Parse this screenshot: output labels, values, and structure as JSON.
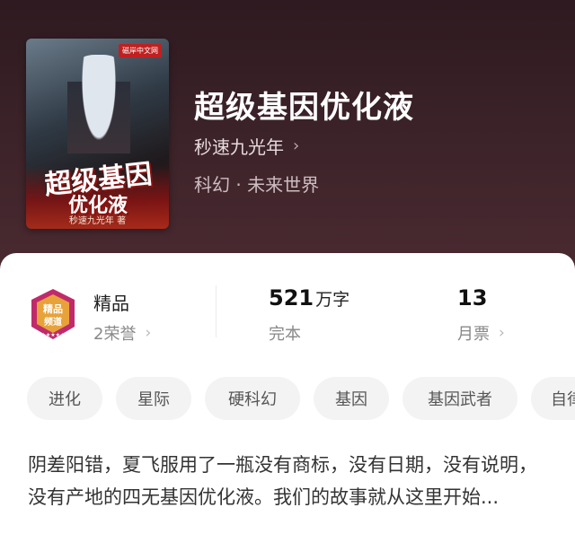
{
  "book": {
    "title": "超级基因优化液",
    "author": "秒速九光年",
    "category": "科幻 · 未来世界",
    "cover": {
      "title_line1": "超级基因",
      "title_line2": "优化液",
      "author_line": "秒速九光年 著",
      "publisher_badge": "磁岸中文网"
    }
  },
  "stats": {
    "badge_label": "精品",
    "honor": "2荣誉",
    "word_count_value": "521",
    "word_count_unit": "万字",
    "status": "完本",
    "monthly_votes_value": "13",
    "monthly_votes_label": "月票"
  },
  "tags": [
    "进化",
    "星际",
    "硬科幻",
    "基因",
    "基因武者",
    "自律"
  ],
  "description": "阴差阳错，夏飞服用了一瓶没有商标，没有日期，没有说明，没有产地的四无基因优化液。我们的故事就从这里开始...",
  "colors": {
    "hero_bg": "#3a2228",
    "sheet_bg": "#ffffff",
    "tag_bg": "#f3f3f3",
    "medal": "#c02a6b"
  }
}
